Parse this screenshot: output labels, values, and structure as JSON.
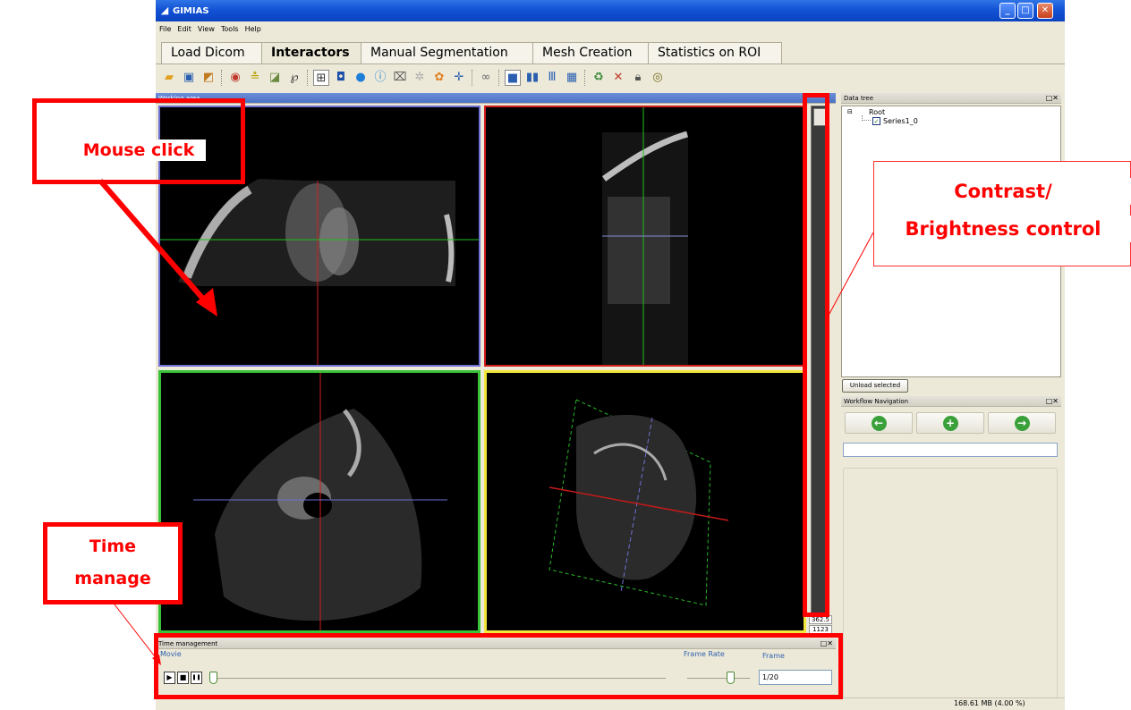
{
  "window": {
    "title": "GIMIAS",
    "minimize": "_",
    "maximize": "□",
    "close": "✕"
  },
  "menu": [
    "File",
    "Edit",
    "View",
    "Tools",
    "Help"
  ],
  "tabs": [
    "Load Dicom",
    "Interactors",
    "Manual Segmentation",
    "Mesh Creation",
    "Statistics on ROI"
  ],
  "active_tab": "Interactors",
  "toolbar_icons": [
    "open-folder-icon",
    "save-icon",
    "import-icon",
    "target-icon",
    "ruler-icon",
    "landmark-icon",
    "lasso-icon",
    "tree-view-icon",
    "single-view-icon",
    "sphere-icon",
    "info-icon",
    "crop-icon",
    "gear-icon",
    "palette-icon",
    "crosshair-icon",
    "link-icon",
    "layout-1x1-icon",
    "layout-2-icon",
    "layout-3-icon",
    "layout-grid-icon",
    "reset-icon",
    "cursor-icon",
    "lock-icon",
    "eye-icon"
  ],
  "working_area": {
    "title": "Working area",
    "readout_top": "362.5",
    "readout_bottom": "1123"
  },
  "data_tree": {
    "title": "Data tree",
    "root_label": "Root",
    "series_label": "Series1_0",
    "unload_button": "Unload selected",
    "controls": "□✕"
  },
  "workflow": {
    "title": "Workflow Navigation",
    "controls": "□✕",
    "back": "←",
    "add": "+",
    "forward": "→"
  },
  "time_management": {
    "title": "Time management",
    "controls": "□✕",
    "movie_label": "Movie",
    "frame_rate_label": "Frame Rate",
    "frame_label": "Frame",
    "frame_value": "1/20",
    "play": "▶",
    "stop": "■",
    "pause": "❚❚"
  },
  "status": {
    "memory": "168.61 MB (4.00 %)"
  },
  "annotations": {
    "mouse_click": "Mouse click",
    "contrast_line1": "Contrast/",
    "contrast_line2": "Brightness control",
    "time_line1": "Time",
    "time_line2": "manage"
  },
  "colors": {
    "annotation": "#ff0000",
    "view_axial": "#6f6fd4",
    "view_sagittal": "#d01e1e",
    "view_coronal": "#3bc23b",
    "view_3d": "#f2e63c"
  }
}
